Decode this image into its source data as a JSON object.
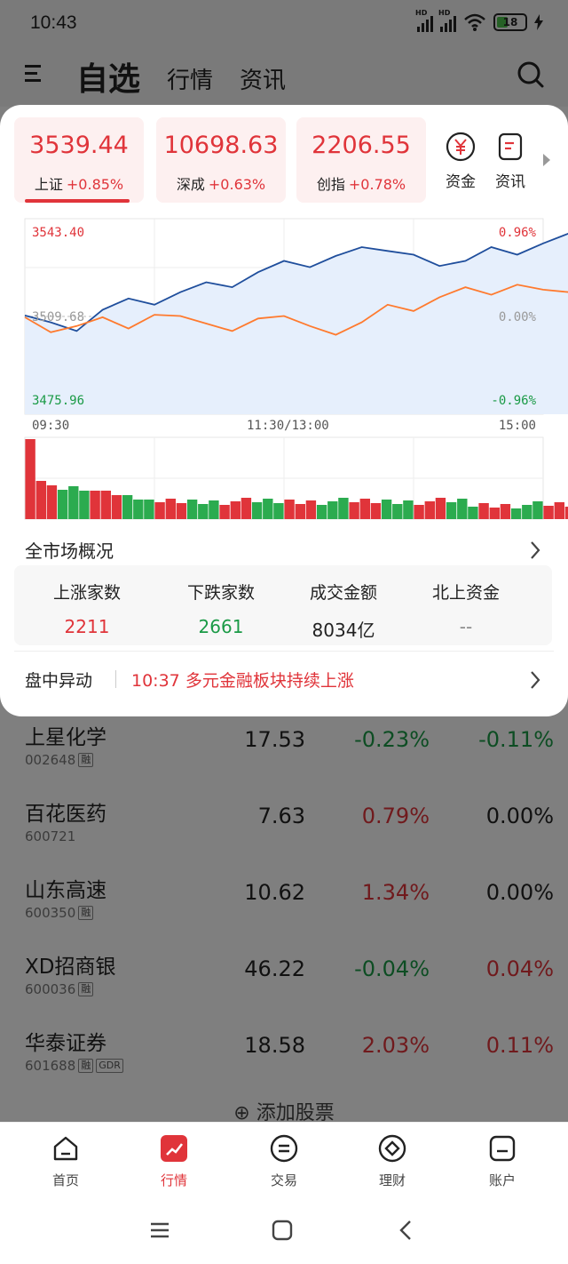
{
  "status": {
    "time": "10:43",
    "battery": "18"
  },
  "header": {
    "active_tab": "自选",
    "tab2": "行情",
    "tab3": "资讯"
  },
  "indices": [
    {
      "value": "3539.44",
      "name": "上证",
      "change": "+0.85%"
    },
    {
      "value": "10698.63",
      "name": "深成",
      "change": "+0.63%"
    },
    {
      "value": "2206.55",
      "name": "创指",
      "change": "+0.78%"
    }
  ],
  "quick_links": [
    {
      "label": "资金",
      "icon": "yuan-icon"
    },
    {
      "label": "资讯",
      "icon": "news-icon"
    }
  ],
  "chart": {
    "high": "3543.40",
    "mid": "3509.68",
    "low": "3475.96",
    "pct_high": "0.96%",
    "pct_mid": "0.00%",
    "pct_low": "-0.96%",
    "time_start": "09:30",
    "time_mid": "11:30/13:00",
    "time_end": "15:00"
  },
  "chart_data": {
    "type": "line",
    "title": "",
    "x_ticks": [
      "09:30",
      "11:30/13:00",
      "15:00"
    ],
    "ylim": [
      3475.96,
      3543.4
    ],
    "series": [
      {
        "name": "",
        "color": "#1f4e9c",
        "values": [
          3509.7,
          3507.0,
          3503.5,
          3512.0,
          3516.5,
          3514.0,
          3519.0,
          3523.0,
          3521.0,
          3527.0,
          3531.5,
          3529.0,
          3533.5,
          3537.0,
          3535.5,
          3534.0,
          3529.5,
          3531.5,
          3537.0,
          3534.0,
          3538.5,
          3542.5,
          3539.0,
          3543.4,
          3541.0,
          3540.5
        ]
      },
      {
        "name": "",
        "color": "#ff7a2e",
        "values": [
          3509.0,
          3503.0,
          3505.5,
          3509.0,
          3504.5,
          3510.0,
          3509.5,
          3506.5,
          3503.5,
          3508.5,
          3509.5,
          3505.5,
          3502.0,
          3507.0,
          3514.0,
          3511.5,
          3517.0,
          3521.0,
          3518.0,
          3522.0,
          3520.0,
          3519.0
        ]
      }
    ],
    "volume_colors": [
      "#e0343a",
      "#2bab4f"
    ]
  },
  "overview": {
    "title": "全市场概况",
    "stats": [
      {
        "label": "上涨家数",
        "value": "2211",
        "color": "#e0343a"
      },
      {
        "label": "下跌家数",
        "value": "2661",
        "color": "#1a9a46"
      },
      {
        "label": "成交金额",
        "value": "8034亿",
        "color": "#222222"
      },
      {
        "label": "北上资金",
        "value": "--",
        "color": "#888888"
      }
    ]
  },
  "alert": {
    "label": "盘中异动",
    "time": "10:37",
    "text": "多元金融板块持续上涨"
  },
  "stocks": [
    {
      "name": "上星化学",
      "code": "002648",
      "tags": [
        "融"
      ],
      "price": "17.53",
      "pct": "-0.23%",
      "pct_color": "#1a9a46",
      "chg": "-0.11%",
      "chg_color": "#1a9a46"
    },
    {
      "name": "百花医药",
      "code": "600721",
      "tags": [],
      "price": "7.63",
      "pct": "0.79%",
      "pct_color": "#e0343a",
      "chg": "0.00%",
      "chg_color": "#222222"
    },
    {
      "name": "山东高速",
      "code": "600350",
      "tags": [
        "融"
      ],
      "price": "10.62",
      "pct": "1.34%",
      "pct_color": "#e0343a",
      "chg": "0.00%",
      "chg_color": "#222222"
    },
    {
      "name": "XD招商银",
      "code": "600036",
      "tags": [
        "融"
      ],
      "price": "46.22",
      "pct": "-0.04%",
      "pct_color": "#1a9a46",
      "chg": "0.04%",
      "chg_color": "#e0343a"
    },
    {
      "name": "华泰证券",
      "code": "601688",
      "tags": [
        "融",
        "GDR"
      ],
      "price": "18.58",
      "pct": "2.03%",
      "pct_color": "#e0343a",
      "chg": "0.11%",
      "chg_color": "#e0343a"
    }
  ],
  "add_stock": "添加股票",
  "nav": [
    {
      "label": "首页",
      "icon": "home-icon",
      "active": false
    },
    {
      "label": "行情",
      "icon": "market-icon",
      "active": true
    },
    {
      "label": "交易",
      "icon": "trade-icon",
      "active": false
    },
    {
      "label": "理财",
      "icon": "wealth-icon",
      "active": false
    },
    {
      "label": "账户",
      "icon": "account-icon",
      "active": false
    }
  ],
  "colors": {
    "up": "#e0343a",
    "down": "#1a9a46",
    "accent": "#e0343a"
  }
}
